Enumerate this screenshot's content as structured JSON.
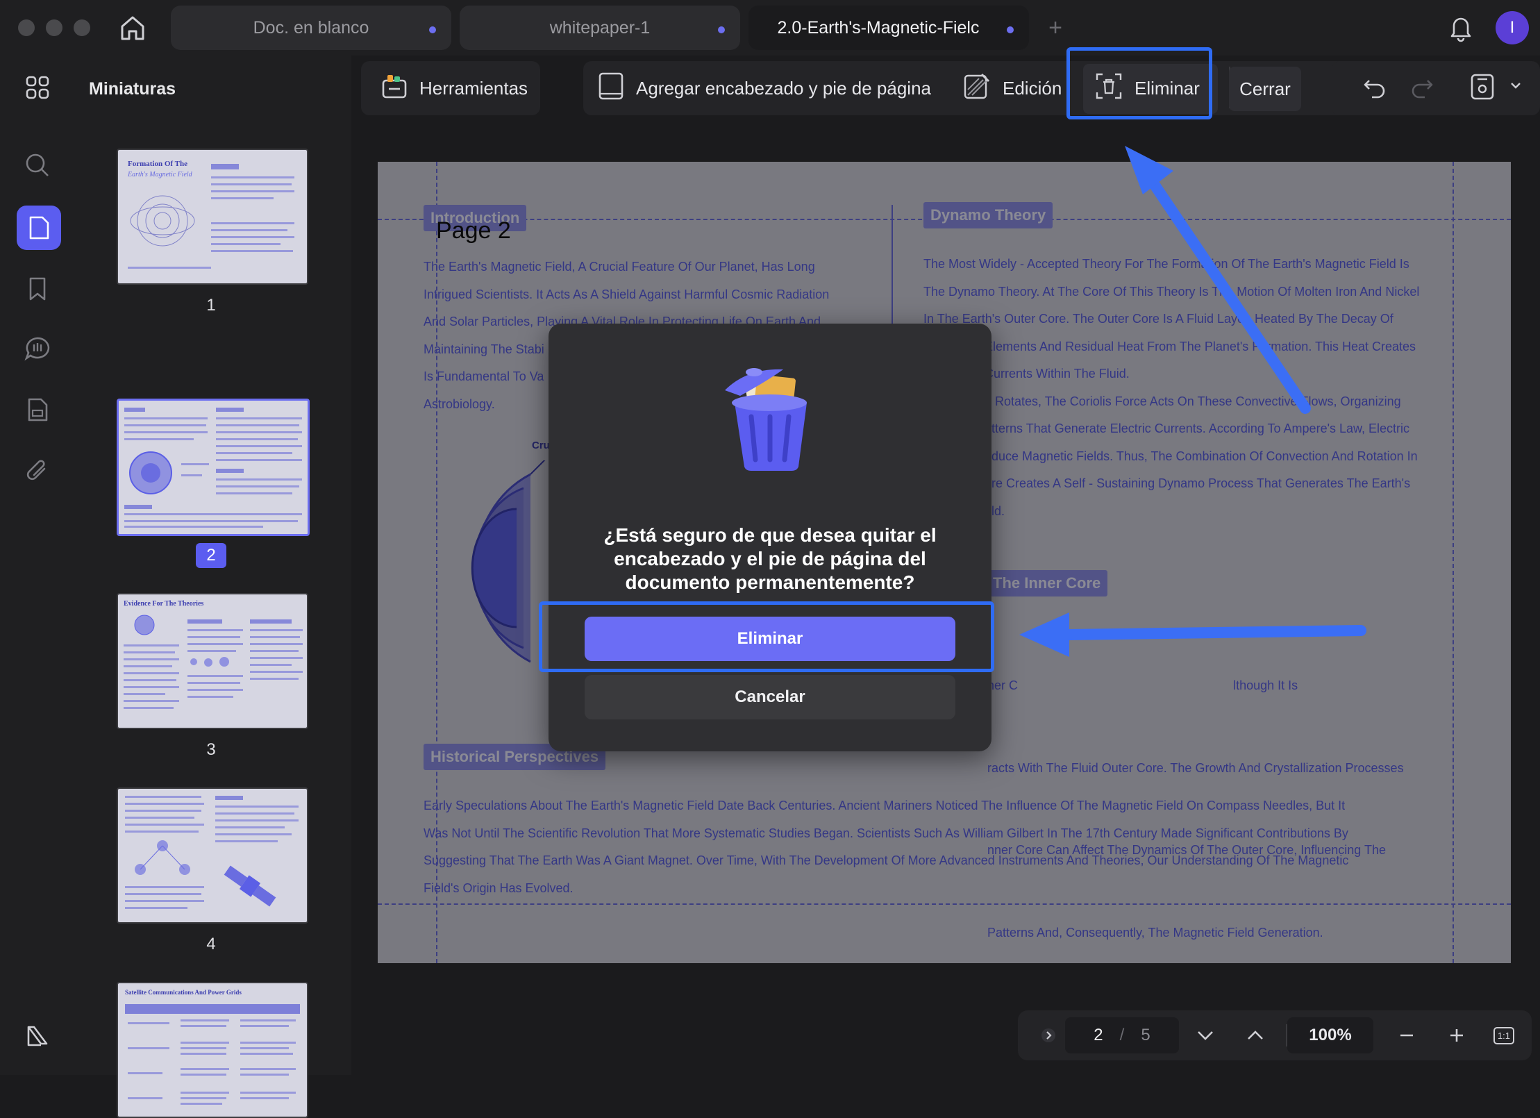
{
  "window": {
    "tabs": [
      {
        "label": "Doc. en blanco",
        "active": false
      },
      {
        "label": "whitepaper-1",
        "active": false
      },
      {
        "label": "2.0-Earth's-Magnetic-Fielc",
        "active": true
      }
    ],
    "avatar_letter": "I"
  },
  "sidebar": {
    "title": "Miniaturas",
    "pages": [
      "1",
      "2",
      "3",
      "4",
      ""
    ],
    "selected_page": "2",
    "thumb_titles": {
      "p1_title": "Formation Of The",
      "p1_sub": "Earth's Magnetic Field",
      "p3_title": "Evidence For The Theories",
      "p5_title": "Satellite Communications And Power Grids"
    }
  },
  "toolbar": {
    "tools_label": "Herramientas",
    "header_footer_label": "Agregar encabezado y pie de página",
    "edit_label": "Edición",
    "delete_label": "Eliminar",
    "close_label": "Cerrar"
  },
  "document": {
    "page_label": "Page 2",
    "intro_heading": "Introduction",
    "intro_lines": [
      "The Earth's Magnetic Field, A Crucial Feature Of Our Planet, Has Long",
      "Intrigued Scientists. It Acts As A Shield Against Harmful Cosmic Radiation",
      "And Solar Particles, Playing A Vital Role In Protecting Life On Earth And",
      "Maintaining The Stabi",
      "Is Fundamental To Va",
      "Astrobiology."
    ],
    "crust_label": "Cru",
    "dynamo_heading": "Dynamo Theory",
    "dynamo_lines": [
      "The Most Widely - Accepted Theory For The Formation Of The Earth's Magnetic Field Is",
      "The Dynamo Theory. At The Core Of This Theory Is The Motion Of Molten Iron And Nickel",
      "In The Earth's Outer Core. The Outer Core Is A Fluid Layer, Heated By The Decay Of",
      "Elements And Residual Heat From The Planet's Formation. This Heat Creates",
      "Currents Within The Fluid.",
      "h Rotates, The Coriolis Force Acts On These Convective Flows, Organizing",
      "atterns That Generate Electric Currents. According To Ampere's Law, Electric",
      "oduce Magnetic Fields. Thus, The Combination Of Convection And Rotation In",
      "ore Creates A Self - Sustaining Dynamo Process That Generates The Earth's",
      "eld."
    ],
    "inner_core_heading": "The Inner Core",
    "inner_core_lines": [
      "ner C                                                              lthough It Is",
      "racts With The Fluid Outer Core. The Growth And Crystallization Processes",
      "nner Core Can Affect The Dynamics Of The Outer Core, Influencing The",
      "Patterns And, Consequently, The Magnetic Field Generation."
    ],
    "historical_heading": "Historical Perspectives",
    "historical_lines": [
      "Early Speculations About The Earth's Magnetic Field Date Back Centuries. Ancient Mariners Noticed The Influence Of The Magnetic Field On Compass Needles, But It",
      "Was Not Until The Scientific Revolution That More Systematic Studies Began. Scientists Such As William Gilbert In The 17th Century Made Significant Contributions By",
      "Suggesting That The Earth Was A Giant Magnet. Over Time, With The Development Of More Advanced Instruments And Theories, Our Understanding Of The Magnetic",
      "Field's Origin Has Evolved."
    ]
  },
  "dialog": {
    "message": "¿Está seguro de que desea quitar el encabezado y el pie de página del documento permanentemente?",
    "confirm_label": "Eliminar",
    "cancel_label": "Cancelar"
  },
  "pagination": {
    "current_page": "2",
    "separator": "/",
    "total_pages": "5",
    "zoom": "100%",
    "fit_label": "1:1"
  },
  "colors": {
    "accent": "#5b5df0",
    "highlight": "#2f6cf5",
    "doc_text": "#5b5fe6"
  }
}
